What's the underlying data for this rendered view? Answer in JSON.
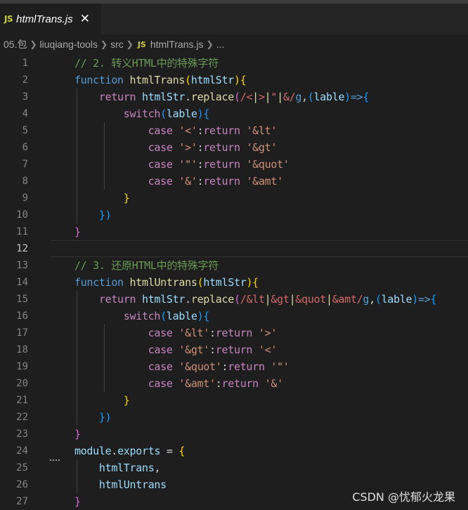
{
  "tab": {
    "badge": "JS",
    "title": "htmlTrans.js",
    "close": "✕"
  },
  "breadcrumb": [
    "05.包",
    "liuqiang-tools",
    "src",
    "htmlTrans.js",
    "..."
  ],
  "breadcrumb_badge": "JS",
  "line_numbers": [
    "1",
    "2",
    "3",
    "4",
    "5",
    "6",
    "7",
    "8",
    "9",
    "10",
    "11",
    "12",
    "13",
    "14",
    "15",
    "16",
    "17",
    "18",
    "19",
    "20",
    "21",
    "22",
    "23",
    "24",
    "25",
    "26",
    "27"
  ],
  "code_lines": [
    "    // 2. 转义HTML中的特殊字符",
    "    function htmlTrans(htmlStr){",
    "        return htmlStr.replace(/<|>|\"|&/g,(lable)=>{",
    "            switch(lable){",
    "                case '<':return '&lt'",
    "                case '>':return '&gt'",
    "                case '\"':return '&quot'",
    "                case '&':return '&amt'",
    "            }",
    "        })",
    "    }",
    "",
    "    // 3. 还原HTML中的特殊字符",
    "    function htmlUntrans(htmlStr){",
    "        return htmlStr.replace(/&lt|&gt|&quot|&amt/g,(lable)=>{",
    "            switch(lable){",
    "                case '&lt':return '>'",
    "                case '&gt':return '<'",
    "                case '&quot':return '\"'",
    "                case '&amt':return '&'",
    "            }",
    "        })",
    "    }",
    "    module.exports = {",
    "        htmlTrans,",
    "        htmlUntrans",
    "    }"
  ],
  "watermark": "CSDN @忧郁火龙果",
  "colors": {
    "background": "#1e1e1e",
    "comment": "#6a9955",
    "keyword": "#569cd6",
    "control": "#c586c0",
    "function": "#dcdcaa",
    "variable": "#9cdcfe",
    "string": "#ce9178",
    "regex": "#d16969"
  }
}
